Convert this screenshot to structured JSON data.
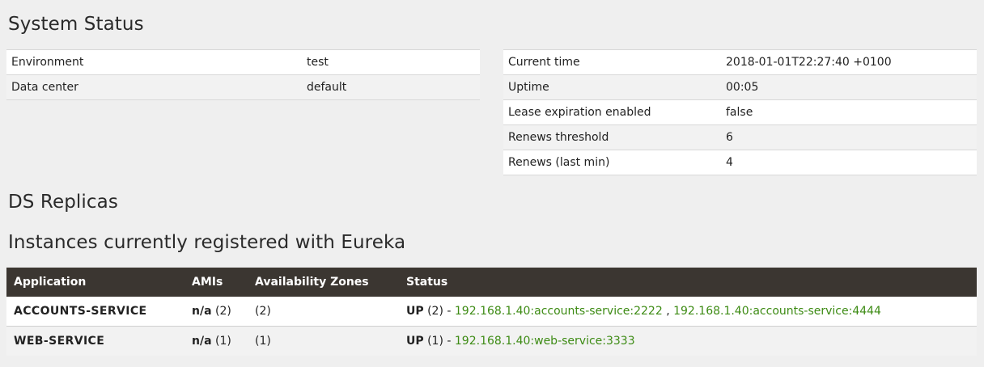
{
  "headings": {
    "system_status": "System Status",
    "ds_replicas": "DS Replicas",
    "instances": "Instances currently registered with Eureka"
  },
  "system_left": [
    {
      "key": "Environment",
      "value": "test"
    },
    {
      "key": "Data center",
      "value": "default"
    }
  ],
  "system_right": [
    {
      "key": "Current time",
      "value": "2018-01-01T22:27:40 +0100"
    },
    {
      "key": "Uptime",
      "value": "00:05"
    },
    {
      "key": "Lease expiration enabled",
      "value": "false"
    },
    {
      "key": "Renews threshold",
      "value": "6"
    },
    {
      "key": "Renews (last min)",
      "value": "4"
    }
  ],
  "instances_table": {
    "headers": [
      "Application",
      "AMIs",
      "Availability Zones",
      "Status"
    ],
    "rows": [
      {
        "application": "ACCOUNTS-SERVICE",
        "ami": "n/a",
        "ami_count": "(2)",
        "zones": "(2)",
        "status": "UP",
        "status_count": "(2) -",
        "links": [
          "192.168.1.40:accounts-service:2222",
          "192.168.1.40:accounts-service:4444"
        ],
        "link_sep": ","
      },
      {
        "application": "WEB-SERVICE",
        "ami": "n/a",
        "ami_count": "(1)",
        "zones": "(1)",
        "status": "UP",
        "status_count": "(1) -",
        "links": [
          "192.168.1.40:web-service:3333"
        ]
      }
    ]
  },
  "colors": {
    "header_bg": "#3b3631",
    "link": "#3d8b14",
    "page_bg": "#efefef"
  }
}
